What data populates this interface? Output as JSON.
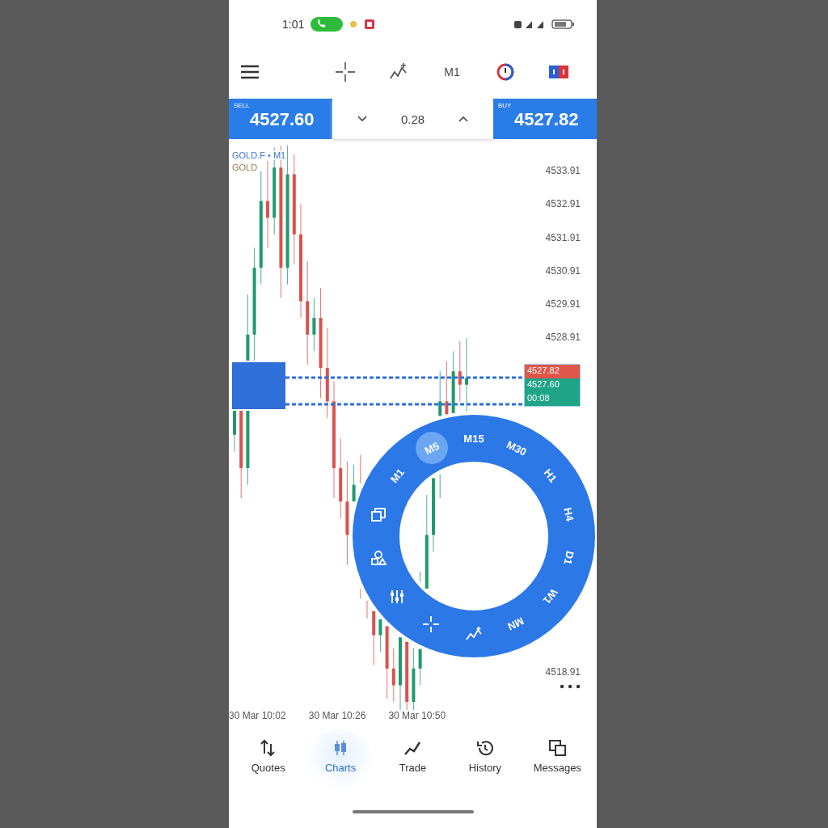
{
  "status_bar": {
    "time": "1:01"
  },
  "toolbar": {
    "timeframe": "M1"
  },
  "trade_bar": {
    "sell": {
      "label": "SELL",
      "price": "4527.60"
    },
    "spread": "0.28",
    "buy": {
      "label": "BUY",
      "price": "4527.82"
    }
  },
  "chart": {
    "symbol": "GOLD.F • M1",
    "description": "GOLD",
    "price_axis": [
      "4533.91",
      "4532.91",
      "4531.91",
      "4530.91",
      "4529.91",
      "4528.91"
    ],
    "price_tags": [
      {
        "text": "4527.82",
        "color": "#e0564b"
      },
      {
        "text": "4527.60",
        "color": "#1fa487"
      },
      {
        "text": "00:08",
        "color": "#1fa487"
      }
    ],
    "bottom_price": "4518.91",
    "time_axis": [
      "30 Mar 10:02",
      "30 Mar 10:26",
      "30 Mar 10:50"
    ]
  },
  "timeframe_wheel": {
    "items": [
      {
        "kind": "timeframe",
        "label": "M1",
        "selected": false
      },
      {
        "kind": "timeframe",
        "label": "M5",
        "selected": true
      },
      {
        "kind": "timeframe",
        "label": "M15",
        "selected": false
      },
      {
        "kind": "timeframe",
        "label": "M30",
        "selected": false
      },
      {
        "kind": "timeframe",
        "label": "H1",
        "selected": false
      },
      {
        "kind": "timeframe",
        "label": "H4",
        "selected": false
      },
      {
        "kind": "timeframe",
        "label": "D1",
        "selected": false
      },
      {
        "kind": "timeframe",
        "label": "W1",
        "selected": false
      },
      {
        "kind": "timeframe",
        "label": "MN",
        "selected": false
      },
      {
        "kind": "indicator",
        "selected": false
      },
      {
        "kind": "crosshair",
        "selected": false
      },
      {
        "kind": "sliders",
        "selected": false
      },
      {
        "kind": "shapes",
        "selected": false
      },
      {
        "kind": "windows",
        "selected": false
      }
    ]
  },
  "bottom_nav": [
    {
      "label": "Quotes",
      "selected": false
    },
    {
      "label": "Charts",
      "selected": true
    },
    {
      "label": "Trade",
      "selected": false
    },
    {
      "label": "History",
      "selected": false
    },
    {
      "label": "Messages",
      "selected": false
    }
  ]
}
